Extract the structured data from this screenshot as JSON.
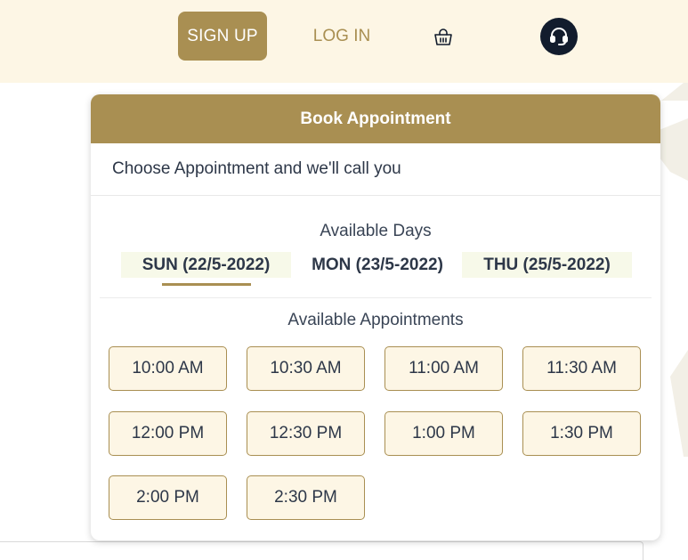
{
  "nav": {
    "signup_label": "SIGN UP",
    "login_label": "LOG IN",
    "basket_icon": "basket-icon",
    "support_icon": "headset-icon"
  },
  "colors": {
    "accent": "#a98f52",
    "topbar_bg": "#fdf6e5",
    "slot_bg": "#fdf6e5",
    "support_bg": "#121c2d",
    "day_tab_bg": "#f7f9e9"
  },
  "card": {
    "title": "Book Appointment",
    "subtitle": "Choose Appointment and we'll call you",
    "days_title": "Available Days",
    "days": [
      {
        "label": "SUN (22/5-2022)",
        "selected": true
      },
      {
        "label": "MON (23/5-2022)",
        "selected": false
      },
      {
        "label": "THU (25/5-2022)",
        "selected": false
      }
    ],
    "appointments_title": "Available Appointments",
    "slots": [
      "10:00 AM",
      "10:30 AM",
      "11:00 AM",
      "11:30 AM",
      "12:00 PM",
      "12:30 PM",
      "1:00 PM",
      "1:30 PM",
      "2:00 PM",
      "2:30 PM"
    ]
  }
}
